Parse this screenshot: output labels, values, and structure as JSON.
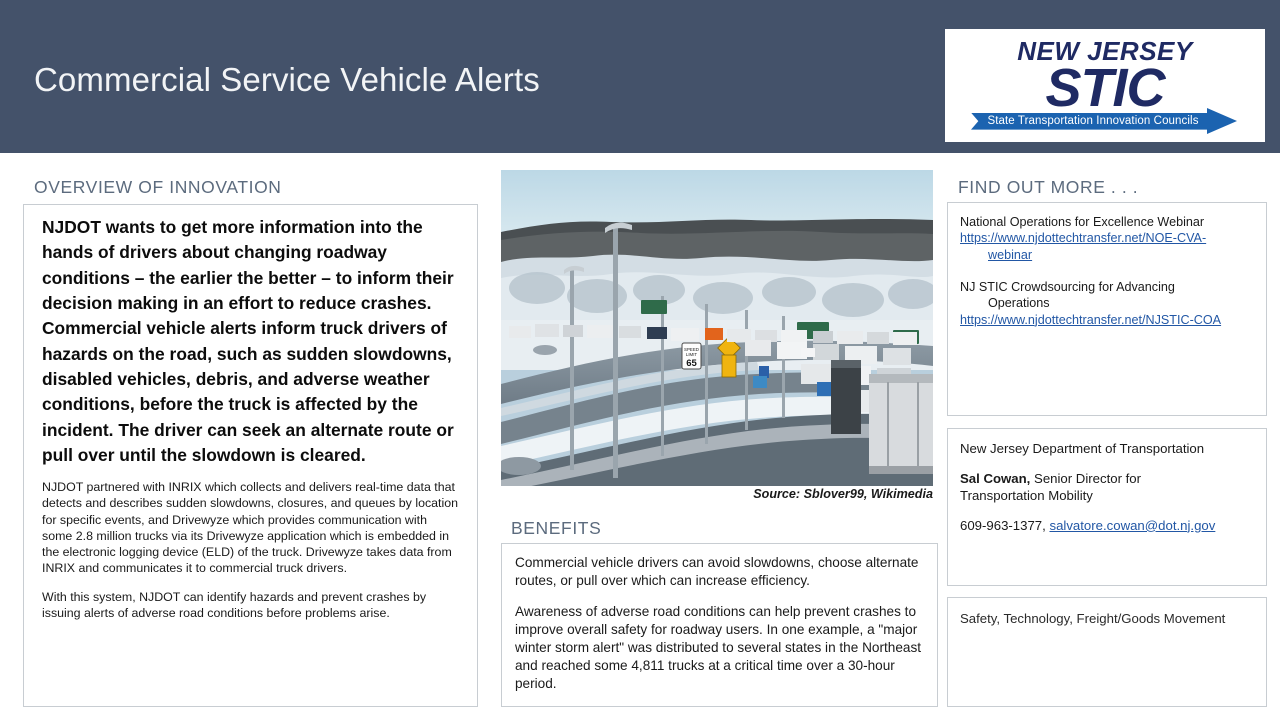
{
  "header": {
    "title": "Commercial Service Vehicle Alerts",
    "background_color": "#44526A",
    "title_color": "#F2F4F6"
  },
  "logo": {
    "top_text": "NEW JERSEY",
    "main_text": "STIC",
    "banner_text": "State Transportation Innovation Councils",
    "brand_color": "#1F2A63",
    "banner_color": "#1B63B0"
  },
  "overview": {
    "heading": "OVERVIEW OF INNOVATION",
    "lead": "NJDOT wants to get more information into the hands of drivers about changing roadway conditions – the earlier the better – to inform their decision making in an effort to reduce crashes.  Commercial vehicle alerts inform truck drivers of hazards on the road, such as sudden slowdowns, disabled vehicles, debris, and adverse weather conditions, before the truck is affected by the incident. The driver can seek an alternate route or pull over until the slowdown is cleared.",
    "paragraph_1": "NJDOT partnered with INRIX which collects and delivers real-time data that detects and describes sudden slowdowns, closures, and queues by location for specific events, and Drivewyze which provides communication with some 2.8 million trucks via its Drivewyze application which is embedded in the electronic logging device (ELD) of the truck. Drivewyze takes data from INRIX and communicates it to commercial truck drivers.",
    "paragraph_2": "With this system, NJDOT can identify hazards and prevent crashes by issuing alerts of adverse road conditions before problems arise."
  },
  "photo": {
    "caption": "Source: Sblover99, Wikimedia",
    "alt_description": "Queue of trucks stopped on a snow-covered highway with frost-covered trees",
    "speed_limit_sign": "65"
  },
  "benefits": {
    "heading": "BENEFITS",
    "paragraph_1": "Commercial vehicle drivers can avoid slowdowns, choose alternate routes, or pull over which can increase efficiency.",
    "paragraph_2": "Awareness of adverse road conditions can help prevent crashes to improve overall safety for roadway users.  In one example, a \"major winter storm alert\" was distributed to several states in the Northeast and reached some 4,811 trucks at a critical time over a 30-hour period."
  },
  "find_out_more": {
    "heading": "FIND OUT MORE . . .",
    "link_1_label": "National Operations for Excellence Webinar",
    "link_1_url": "https://www.njdottechtransfer.net/NOE-CVA-",
    "link_1_url_cont": "webinar",
    "link_2_label": "NJ STIC Crowdsourcing for Advancing",
    "link_2_label_cont": "Operations",
    "link_2_url": "https://www.njdottechtransfer.net/NJSTIC-COA",
    "link_color": "#2257A5"
  },
  "contact": {
    "agency": "New Jersey Department of Transportation",
    "name": "Sal Cowan,",
    "title_line_1": " Senior Director for",
    "title_line_2": "Transportation Mobility",
    "phone": "609-963-1377, ",
    "email": "salvatore.cowan@dot.nj.gov"
  },
  "tags": {
    "text": "Safety, Technology, Freight/Goods Movement"
  }
}
